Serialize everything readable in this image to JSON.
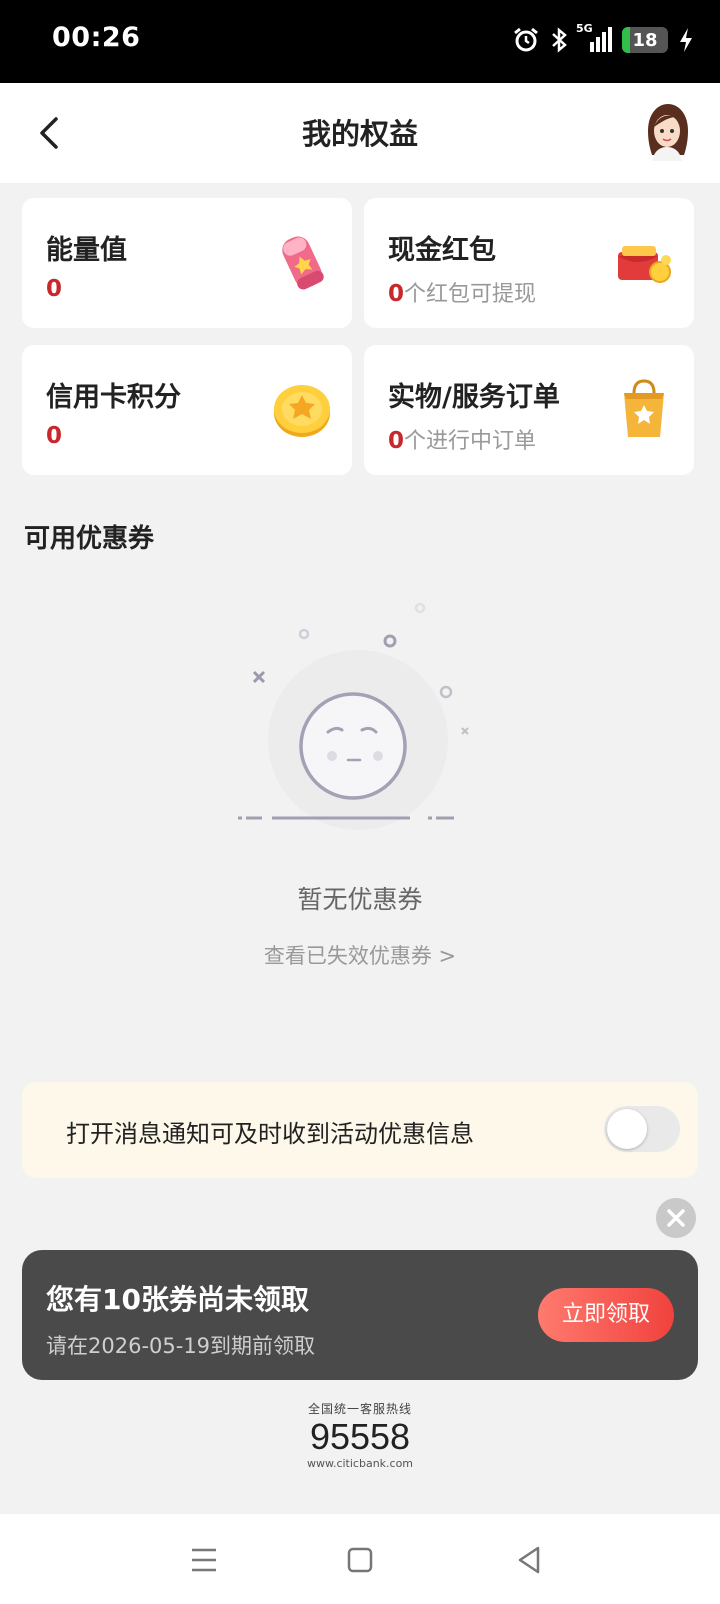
{
  "status": {
    "time": "00:26",
    "network": "5G",
    "battery": "18",
    "battery_level": 0.18
  },
  "header": {
    "title": "我的权益"
  },
  "cards": [
    {
      "title": "能量值",
      "value": "0",
      "suffix": ""
    },
    {
      "title": "现金红包",
      "value": "0",
      "suffix": "个红包可提现"
    },
    {
      "title": "信用卡积分",
      "value": "0",
      "suffix": ""
    },
    {
      "title": "实物/服务订单",
      "value": "0",
      "suffix": "个进行中订单"
    }
  ],
  "coupons": {
    "section_title": "可用优惠券",
    "empty_text": "暂无优惠券",
    "expired_link": "查看已失效优惠券 >"
  },
  "notify": {
    "text": "打开消息通知可及时收到活动优惠信息",
    "enabled": false
  },
  "banner": {
    "title": "您有10张券尚未领取",
    "subtitle": "请在2026-05-19到期前领取",
    "button": "立即领取"
  },
  "hotline": {
    "label": "全国统一客服热线",
    "number": "95558",
    "url": "www.citicbank.com"
  }
}
